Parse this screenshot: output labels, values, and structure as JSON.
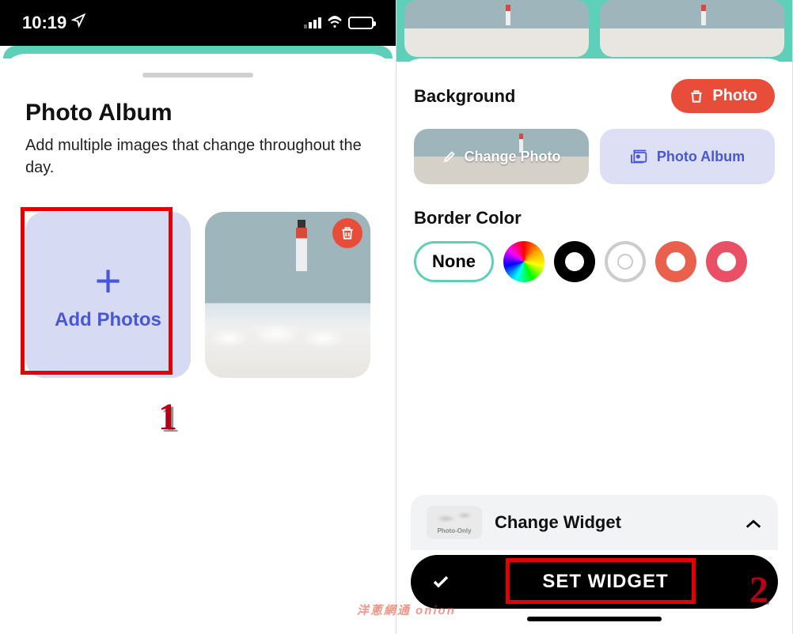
{
  "left": {
    "status": {
      "time": "10:19"
    },
    "sheet": {
      "title": "Photo Album",
      "subtitle": "Add multiple images that change throughout the day."
    },
    "add_card": {
      "plus": "+",
      "label": "Add Photos"
    },
    "annotation": "1"
  },
  "right": {
    "bg_section": {
      "title": "Background",
      "photo_pill": "Photo"
    },
    "buttons": {
      "change_photo": "Change Photo",
      "album": "Photo Album"
    },
    "border_section": {
      "title": "Border Color",
      "none": "None"
    },
    "change_widget": {
      "thumb_label": "Photo-Only",
      "label": "Change Widget"
    },
    "set_widget": "SET WIDGET",
    "annotation": "2"
  },
  "watermark": "洋蔥網通 onion"
}
